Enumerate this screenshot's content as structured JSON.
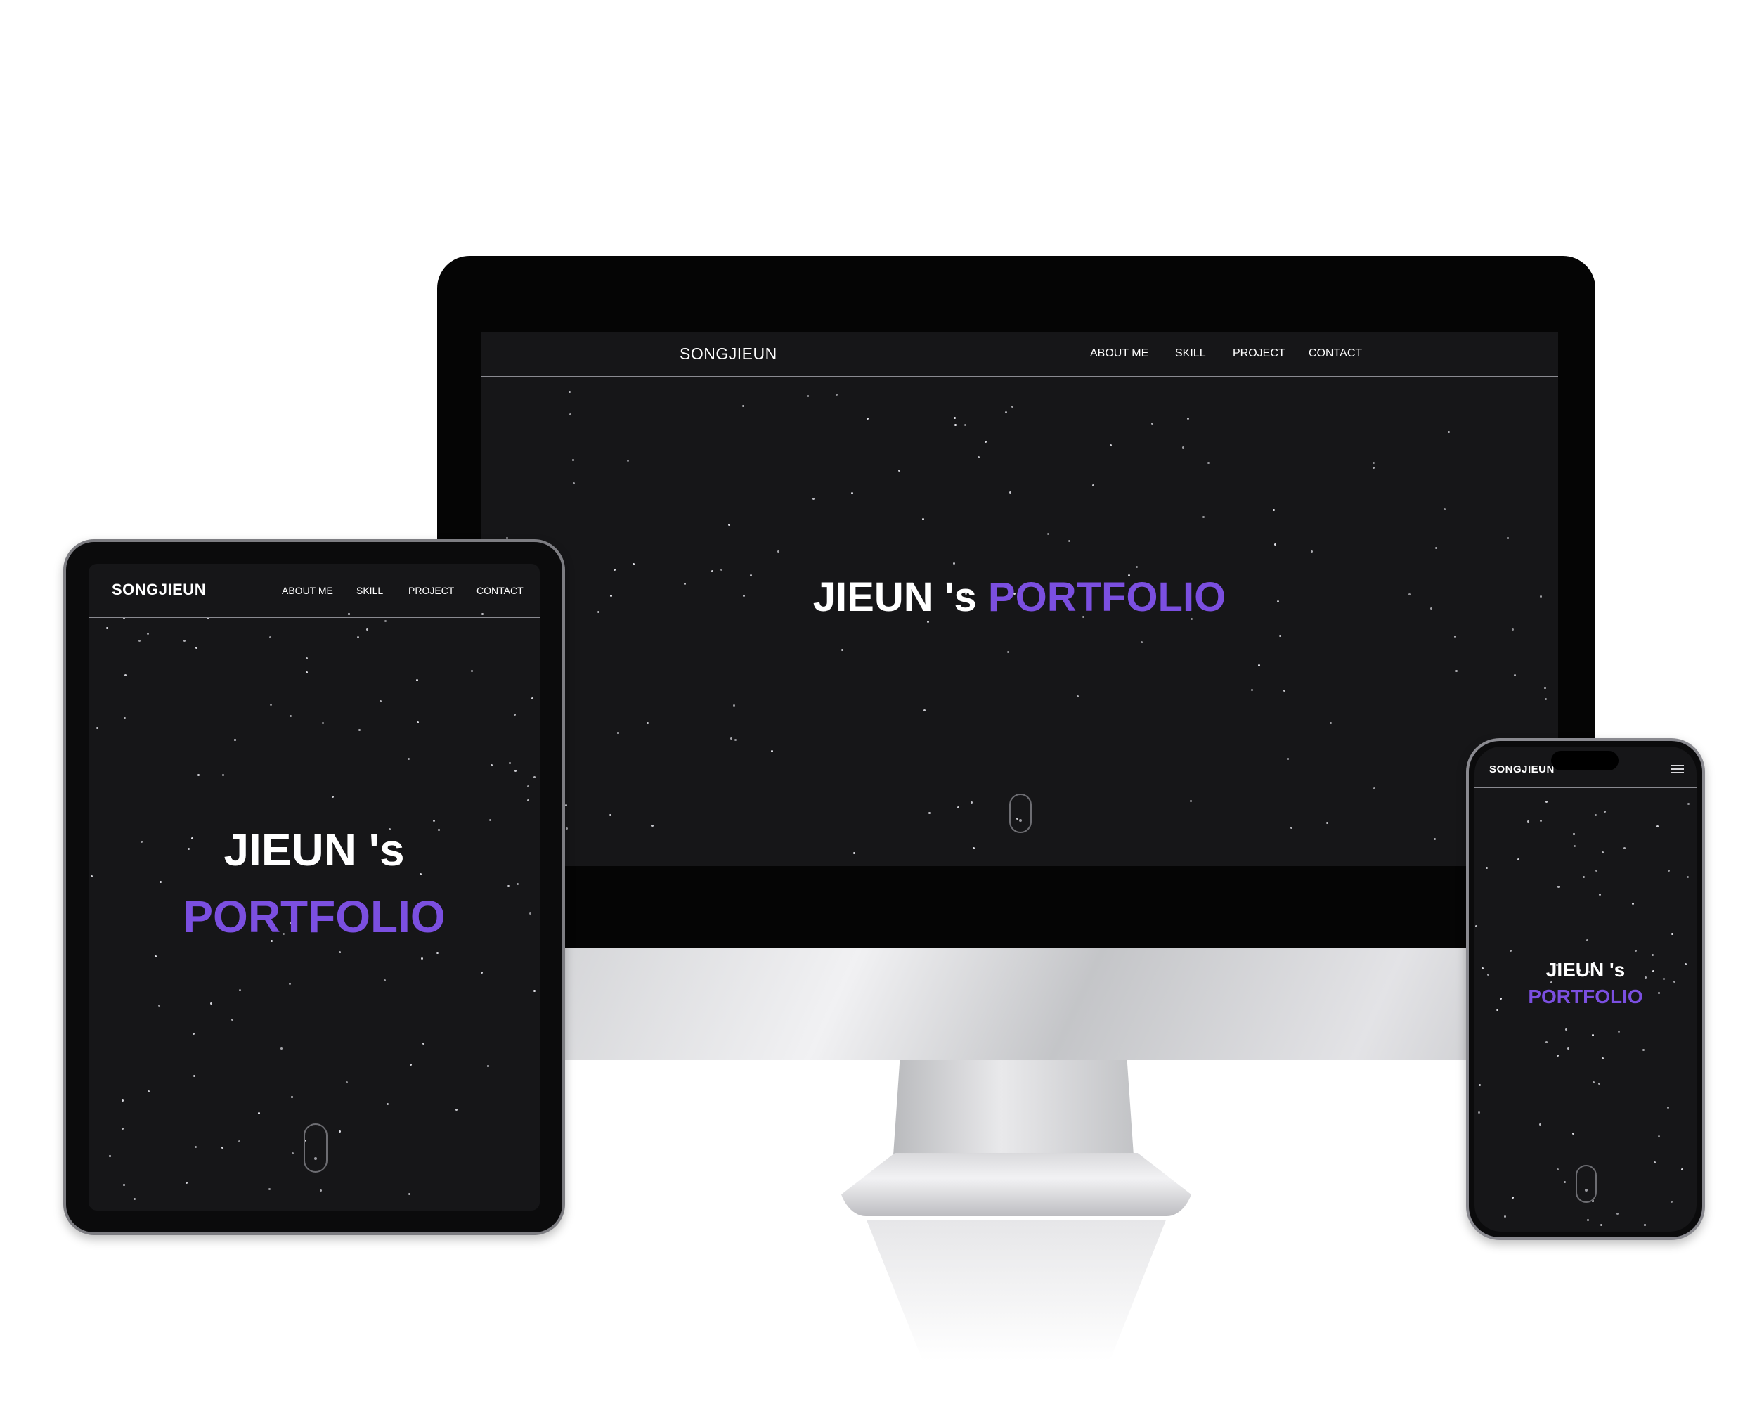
{
  "desktop": {
    "brand": "SONGJIEUN",
    "nav": [
      "ABOUT ME",
      "SKILL",
      "PROJECT",
      "CONTACT"
    ],
    "hero_white": "JIEUN 's",
    "hero_accent": "PORTFOLIO"
  },
  "tablet": {
    "brand": "SONGJIEUN",
    "nav": [
      "ABOUT ME",
      "SKILL",
      "PROJECT",
      "CONTACT"
    ],
    "hero_white": "JIEUN 's",
    "hero_accent": "PORTFOLIO"
  },
  "mobile": {
    "brand": "SONGJIEUN",
    "menu_icon": "hamburger-menu-icon",
    "hero_white": "JIEUN 's",
    "hero_accent": "PORTFOLIO"
  },
  "colors": {
    "background": "#161618",
    "accent": "#7b4fe0",
    "text": "#ffffff"
  }
}
